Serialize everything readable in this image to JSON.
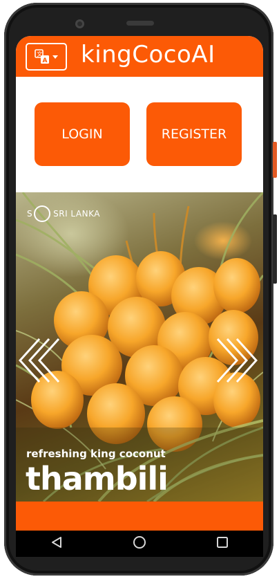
{
  "app": {
    "title": "kingCocoAI"
  },
  "auth": {
    "login_label": "LOGIN",
    "register_label": "REGISTER"
  },
  "banner": {
    "brand_letter": "S",
    "brand_name": "SRI LANKA",
    "tagline": "refreshing king coconut",
    "product_name": "thambili"
  },
  "icons": {
    "language": "translate-icon",
    "dropdown": "chevron-down-icon",
    "prev": "chevron-left-icon",
    "next": "chevron-right-icon",
    "nav_back": "back-triangle-icon",
    "nav_home": "home-circle-icon",
    "nav_recents": "recents-square-icon"
  },
  "colors": {
    "accent": "#fc5a06",
    "on_accent": "#ffffff"
  }
}
